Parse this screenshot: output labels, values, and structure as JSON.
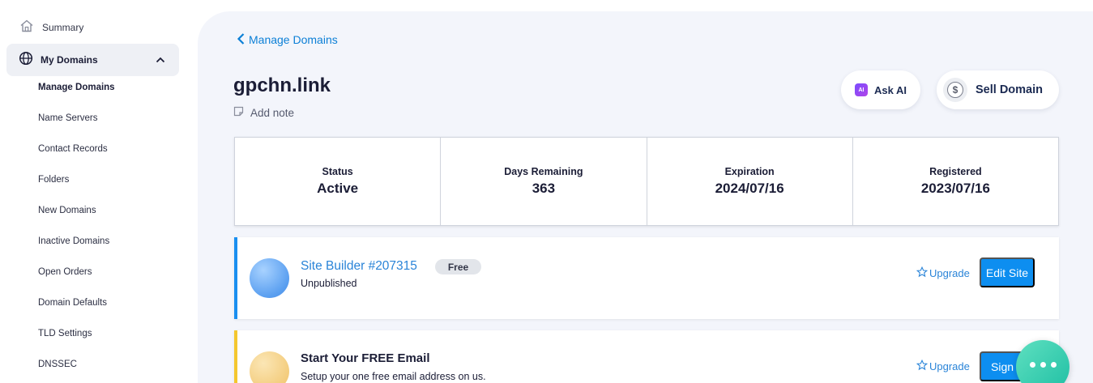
{
  "sidebar": {
    "summary_label": "Summary",
    "my_domains_label": "My Domains",
    "sub_items": [
      {
        "label": "Manage Domains",
        "active": true
      },
      {
        "label": "Name Servers"
      },
      {
        "label": "Contact Records"
      },
      {
        "label": "Folders"
      },
      {
        "label": "New Domains"
      },
      {
        "label": "Inactive Domains"
      },
      {
        "label": "Open Orders"
      },
      {
        "label": "Domain Defaults"
      },
      {
        "label": "TLD Settings"
      },
      {
        "label": "DNSSEC"
      }
    ]
  },
  "header": {
    "back_label": "Manage Domains",
    "domain": "gpchn.link",
    "add_note_label": "Add note",
    "ask_ai_label": "Ask AI",
    "ai_badge": "AI",
    "sell_label": "Sell Domain",
    "sell_icon_glyph": "$"
  },
  "stats": [
    {
      "label": "Status",
      "value": "Active"
    },
    {
      "label": "Days Remaining",
      "value": "363"
    },
    {
      "label": "Expiration",
      "value": "2024/07/16"
    },
    {
      "label": "Registered",
      "value": "2023/07/16"
    }
  ],
  "site_builder": {
    "title": "Site Builder #207315",
    "badge": "Free",
    "subtitle": "Unpublished",
    "upgrade_label": "Upgrade",
    "button_label": "Edit Site"
  },
  "email": {
    "title": "Start Your FREE Email",
    "subtitle": "Setup your one free email address on us.",
    "upgrade_label": "Upgrade",
    "button_label": "Sign In"
  },
  "colors": {
    "accent": "#0d8ef0",
    "link": "#2a84d8",
    "site_builder_bar": "#1a8ff0",
    "email_bar": "#f4c72e",
    "chat": "#2cc9ad"
  },
  "icons": {
    "summary": "home-icon",
    "my_domains": "globe-icon",
    "collapse": "chevron-up-icon",
    "back": "chevron-left-icon",
    "note": "note-icon",
    "ask_ai": "ai-icon",
    "sell": "dollar-icon",
    "upgrade": "star-icon",
    "chat": "chat-icon"
  }
}
